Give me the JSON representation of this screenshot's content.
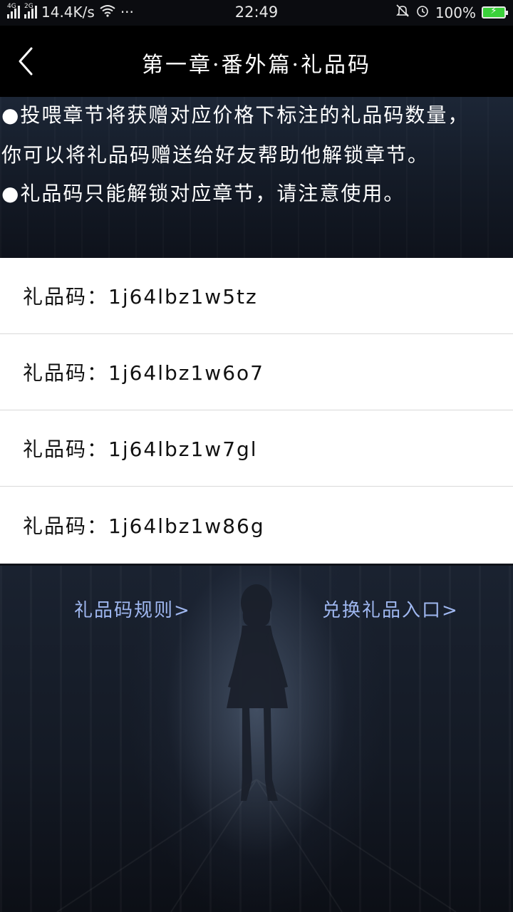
{
  "status_bar": {
    "network_1": "4G",
    "network_2": "2G",
    "speed": "14.4K/s",
    "more": "···",
    "time": "22:49",
    "battery": "100%"
  },
  "header": {
    "title": "第一章·番外篇·礼品码"
  },
  "notice": {
    "line1": "●投喂章节将获赠对应价格下标注的礼品码数量，",
    "line2": "你可以将礼品码赠送给好友帮助他解锁章节。",
    "line3": "●礼品码只能解锁对应章节，请注意使用。"
  },
  "codes": [
    {
      "text": "礼品码：1j64lbz1w5tz"
    },
    {
      "text": "礼品码：1j64lbz1w6o7"
    },
    {
      "text": "礼品码：1j64lbz1w7gl"
    },
    {
      "text": "礼品码：1j64lbz1w86g"
    }
  ],
  "links": {
    "rules": "礼品码规则>",
    "redeem": "兑换礼品入口>"
  },
  "colors": {
    "header_bg": "#000000",
    "link": "#9fb7f0",
    "battery": "#3ad13a"
  }
}
